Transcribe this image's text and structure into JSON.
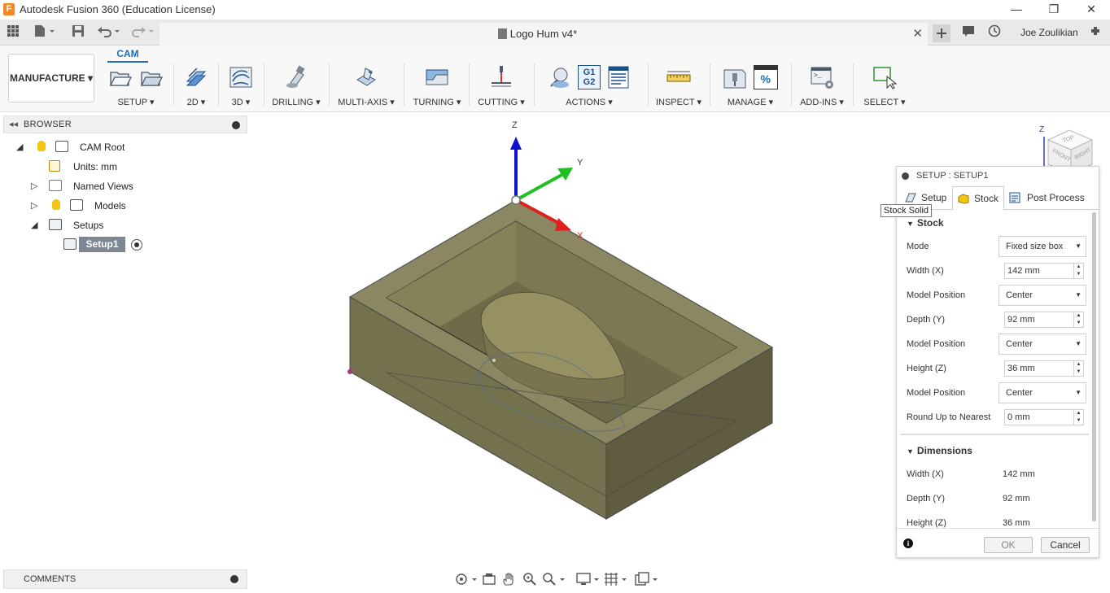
{
  "window": {
    "title": "Autodesk Fusion 360 (Education License)",
    "app_logo": "F",
    "minimize": "—",
    "restore": "❐",
    "close": "✕"
  },
  "quick_access": {
    "document_title": "Logo Hum v4*",
    "close_glyph": "✕",
    "user_name": "Joe Zoulikian"
  },
  "toolbar": {
    "workspace": "MANUFACTURE ▾",
    "active_tab": "CAM",
    "groups": [
      {
        "label": "SETUP ▾"
      },
      {
        "label": "2D ▾"
      },
      {
        "label": "3D ▾"
      },
      {
        "label": "DRILLING ▾"
      },
      {
        "label": "MULTI-AXIS ▾"
      },
      {
        "label": "TURNING ▾"
      },
      {
        "label": "CUTTING ▾"
      },
      {
        "label": "ACTIONS ▾"
      },
      {
        "label": "INSPECT ▾"
      },
      {
        "label": "MANAGE ▾"
      },
      {
        "label": "ADD-INS ▾"
      },
      {
        "label": "SELECT ▾"
      }
    ],
    "actions_g1g2": "G1 G2",
    "manage_percent": "%",
    "addins_prompt": ">_"
  },
  "browser": {
    "header": "BROWSER",
    "items": [
      {
        "label": "CAM Root"
      },
      {
        "label": "Units: mm"
      },
      {
        "label": "Named Views"
      },
      {
        "label": "Models"
      },
      {
        "label": "Setups"
      },
      {
        "label": "Setup1"
      }
    ]
  },
  "comments": {
    "label": "COMMENTS"
  },
  "viewport": {
    "axis_z": "Z",
    "axis_y": "Y",
    "axis_x": "X"
  },
  "viewcube": {
    "axis": "Z",
    "top": "TOP",
    "front": "FRONT",
    "right": "RIGHT"
  },
  "dialog": {
    "title": "SETUP : SETUP1",
    "tabs": [
      {
        "label": "Setup"
      },
      {
        "label": "Stock"
      },
      {
        "label": "Post Process"
      }
    ],
    "active_tab": "Stock",
    "tooltip": "Stock Solid",
    "stock_section": "Stock",
    "fields": {
      "mode_label": "Mode",
      "mode_value": "Fixed size box",
      "width_label": "Width (X)",
      "width_value": "142 mm",
      "model_pos_1_label": "Model Position",
      "model_pos_1_value": "Center",
      "depth_label": "Depth (Y)",
      "depth_value": "92 mm",
      "model_pos_2_label": "Model Position",
      "model_pos_2_value": "Center",
      "height_label": "Height (Z)",
      "height_value": "36 mm",
      "model_pos_3_label": "Model Position",
      "model_pos_3_value": "Center",
      "round_label": "Round Up to Nearest",
      "round_value": "0 mm"
    },
    "dimensions_section": "Dimensions",
    "dimensions": {
      "width_label": "Width (X)",
      "width_value": "142 mm",
      "depth_label": "Depth (Y)",
      "depth_value": "92 mm",
      "height_label": "Height (Z)",
      "height_value": "36 mm"
    },
    "ok": "OK",
    "cancel": "Cancel",
    "info": "i"
  },
  "colors": {
    "accent": "#1e6fb7",
    "stock": "#7a7753",
    "selection": "#7c8793"
  }
}
